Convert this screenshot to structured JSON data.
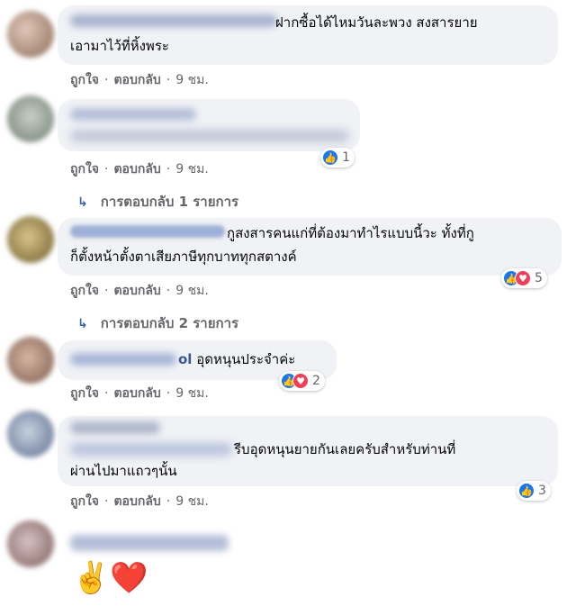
{
  "comments": [
    {
      "text_line1": "ฝากซื้อได้ไหมวันละพวง สงสารยาย",
      "text_line2": "เอามาไว้ที่หิ้งพระ",
      "like": "ถูกใจ",
      "reply": "ตอบกลับ",
      "time": "9 ชม."
    },
    {
      "like": "ถูกใจ",
      "reply": "ตอบกลับ",
      "time": "9 ชม.",
      "reaction_count": "1",
      "replies_label": "การตอบกลับ 1 รายการ"
    },
    {
      "name_partial": "Ngaugue Futienaru",
      "text_line1": "กูสงสารคนแก่ที่ต้องมาทำไรแบบนี้วะ ทั้งที่กู",
      "text_line2": "ก็ตั้งหน้าตั้งตาเสียภาษีทุกบาททุกสตางค์",
      "like": "ถูกใจ",
      "reply": "ตอบกลับ",
      "time": "9 ชม.",
      "reaction_count": "5",
      "replies_label": "การตอบกลับ 2 รายการ"
    },
    {
      "name_partial": "ol",
      "text_line1": "อุดหนุนประจำค่ะ",
      "like": "ถูกใจ",
      "reply": "ตอบกลับ",
      "time": "9 ชม.",
      "reaction_count": "2"
    },
    {
      "text_line1": "รีบอุดหนุนยายกันเลยครับสำหรับท่านที่",
      "text_line2": "ผ่านไปมาแถวๆนั้น",
      "like": "ถูกใจ",
      "reply": "ตอบกลับ",
      "time": "9 ชม.",
      "reaction_count": "3"
    },
    {
      "emoji": "✌️❤️"
    }
  ],
  "colors": {
    "bubble": "#f0f2f5",
    "like_blue": "#1877f2",
    "love_red": "#f33e58",
    "meta_gray": "#65676b"
  }
}
